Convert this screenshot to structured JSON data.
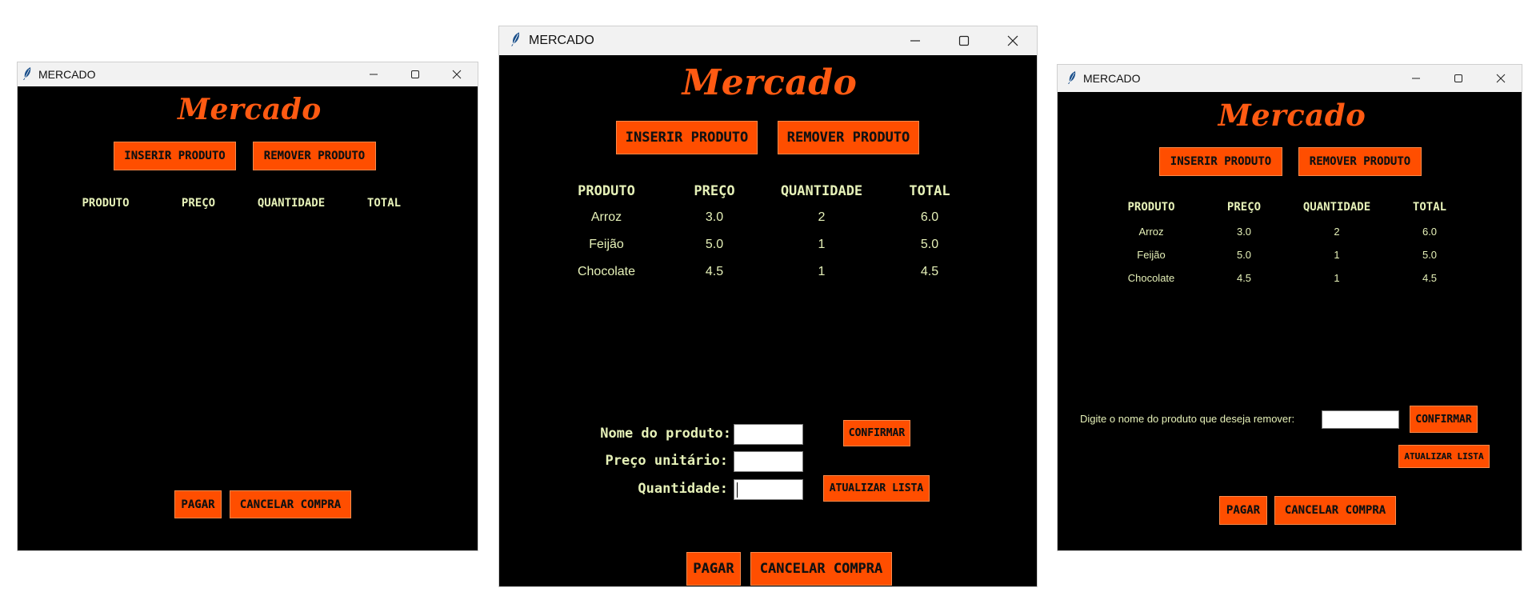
{
  "colors": {
    "accent": "#ff4e00",
    "logo": "#ff5a12",
    "text": "#e6f1b8",
    "background": "#000000"
  },
  "windows": [
    {
      "title": "MERCADO",
      "logo": "Mercado",
      "buttons": {
        "insert": "INSERIR PRODUTO",
        "remove": "REMOVER PRODUTO",
        "pay": "PAGAR",
        "cancel": "CANCELAR COMPRA"
      },
      "columns": [
        "PRODUTO",
        "PREÇO",
        "QUANTIDADE",
        "TOTAL"
      ],
      "rows": []
    },
    {
      "title": "MERCADO",
      "logo": "Mercado",
      "buttons": {
        "insert": "INSERIR PRODUTO",
        "remove": "REMOVER PRODUTO",
        "confirm": "CONFIRMAR",
        "update": "ATUALIZAR LISTA",
        "pay": "PAGAR",
        "cancel": "CANCELAR COMPRA"
      },
      "columns": [
        "PRODUTO",
        "PREÇO",
        "QUANTIDADE",
        "TOTAL"
      ],
      "rows": [
        [
          "Arroz",
          "3.0",
          "2",
          "6.0"
        ],
        [
          "Feijão",
          "5.0",
          "1",
          "5.0"
        ],
        [
          "Chocolate",
          "4.5",
          "1",
          "4.5"
        ]
      ],
      "form": {
        "name_label": "Nome do produto:",
        "name_value": "",
        "price_label": "Preço unitário:",
        "price_value": "",
        "qty_label": "Quantidade:",
        "qty_value": ""
      }
    },
    {
      "title": "MERCADO",
      "logo": "Mercado",
      "buttons": {
        "insert": "INSERIR PRODUTO",
        "remove": "REMOVER PRODUTO",
        "confirm": "CONFIRMAR",
        "update": "ATUALIZAR LISTA",
        "pay": "PAGAR",
        "cancel": "CANCELAR COMPRA"
      },
      "columns": [
        "PRODUTO",
        "PREÇO",
        "QUANTIDADE",
        "TOTAL"
      ],
      "rows": [
        [
          "Arroz",
          "3.0",
          "2",
          "6.0"
        ],
        [
          "Feijão",
          "5.0",
          "1",
          "5.0"
        ],
        [
          "Chocolate",
          "4.5",
          "1",
          "4.5"
        ]
      ],
      "remove_prompt": "Digite o nome do produto que deseja remover:",
      "remove_value": ""
    }
  ]
}
